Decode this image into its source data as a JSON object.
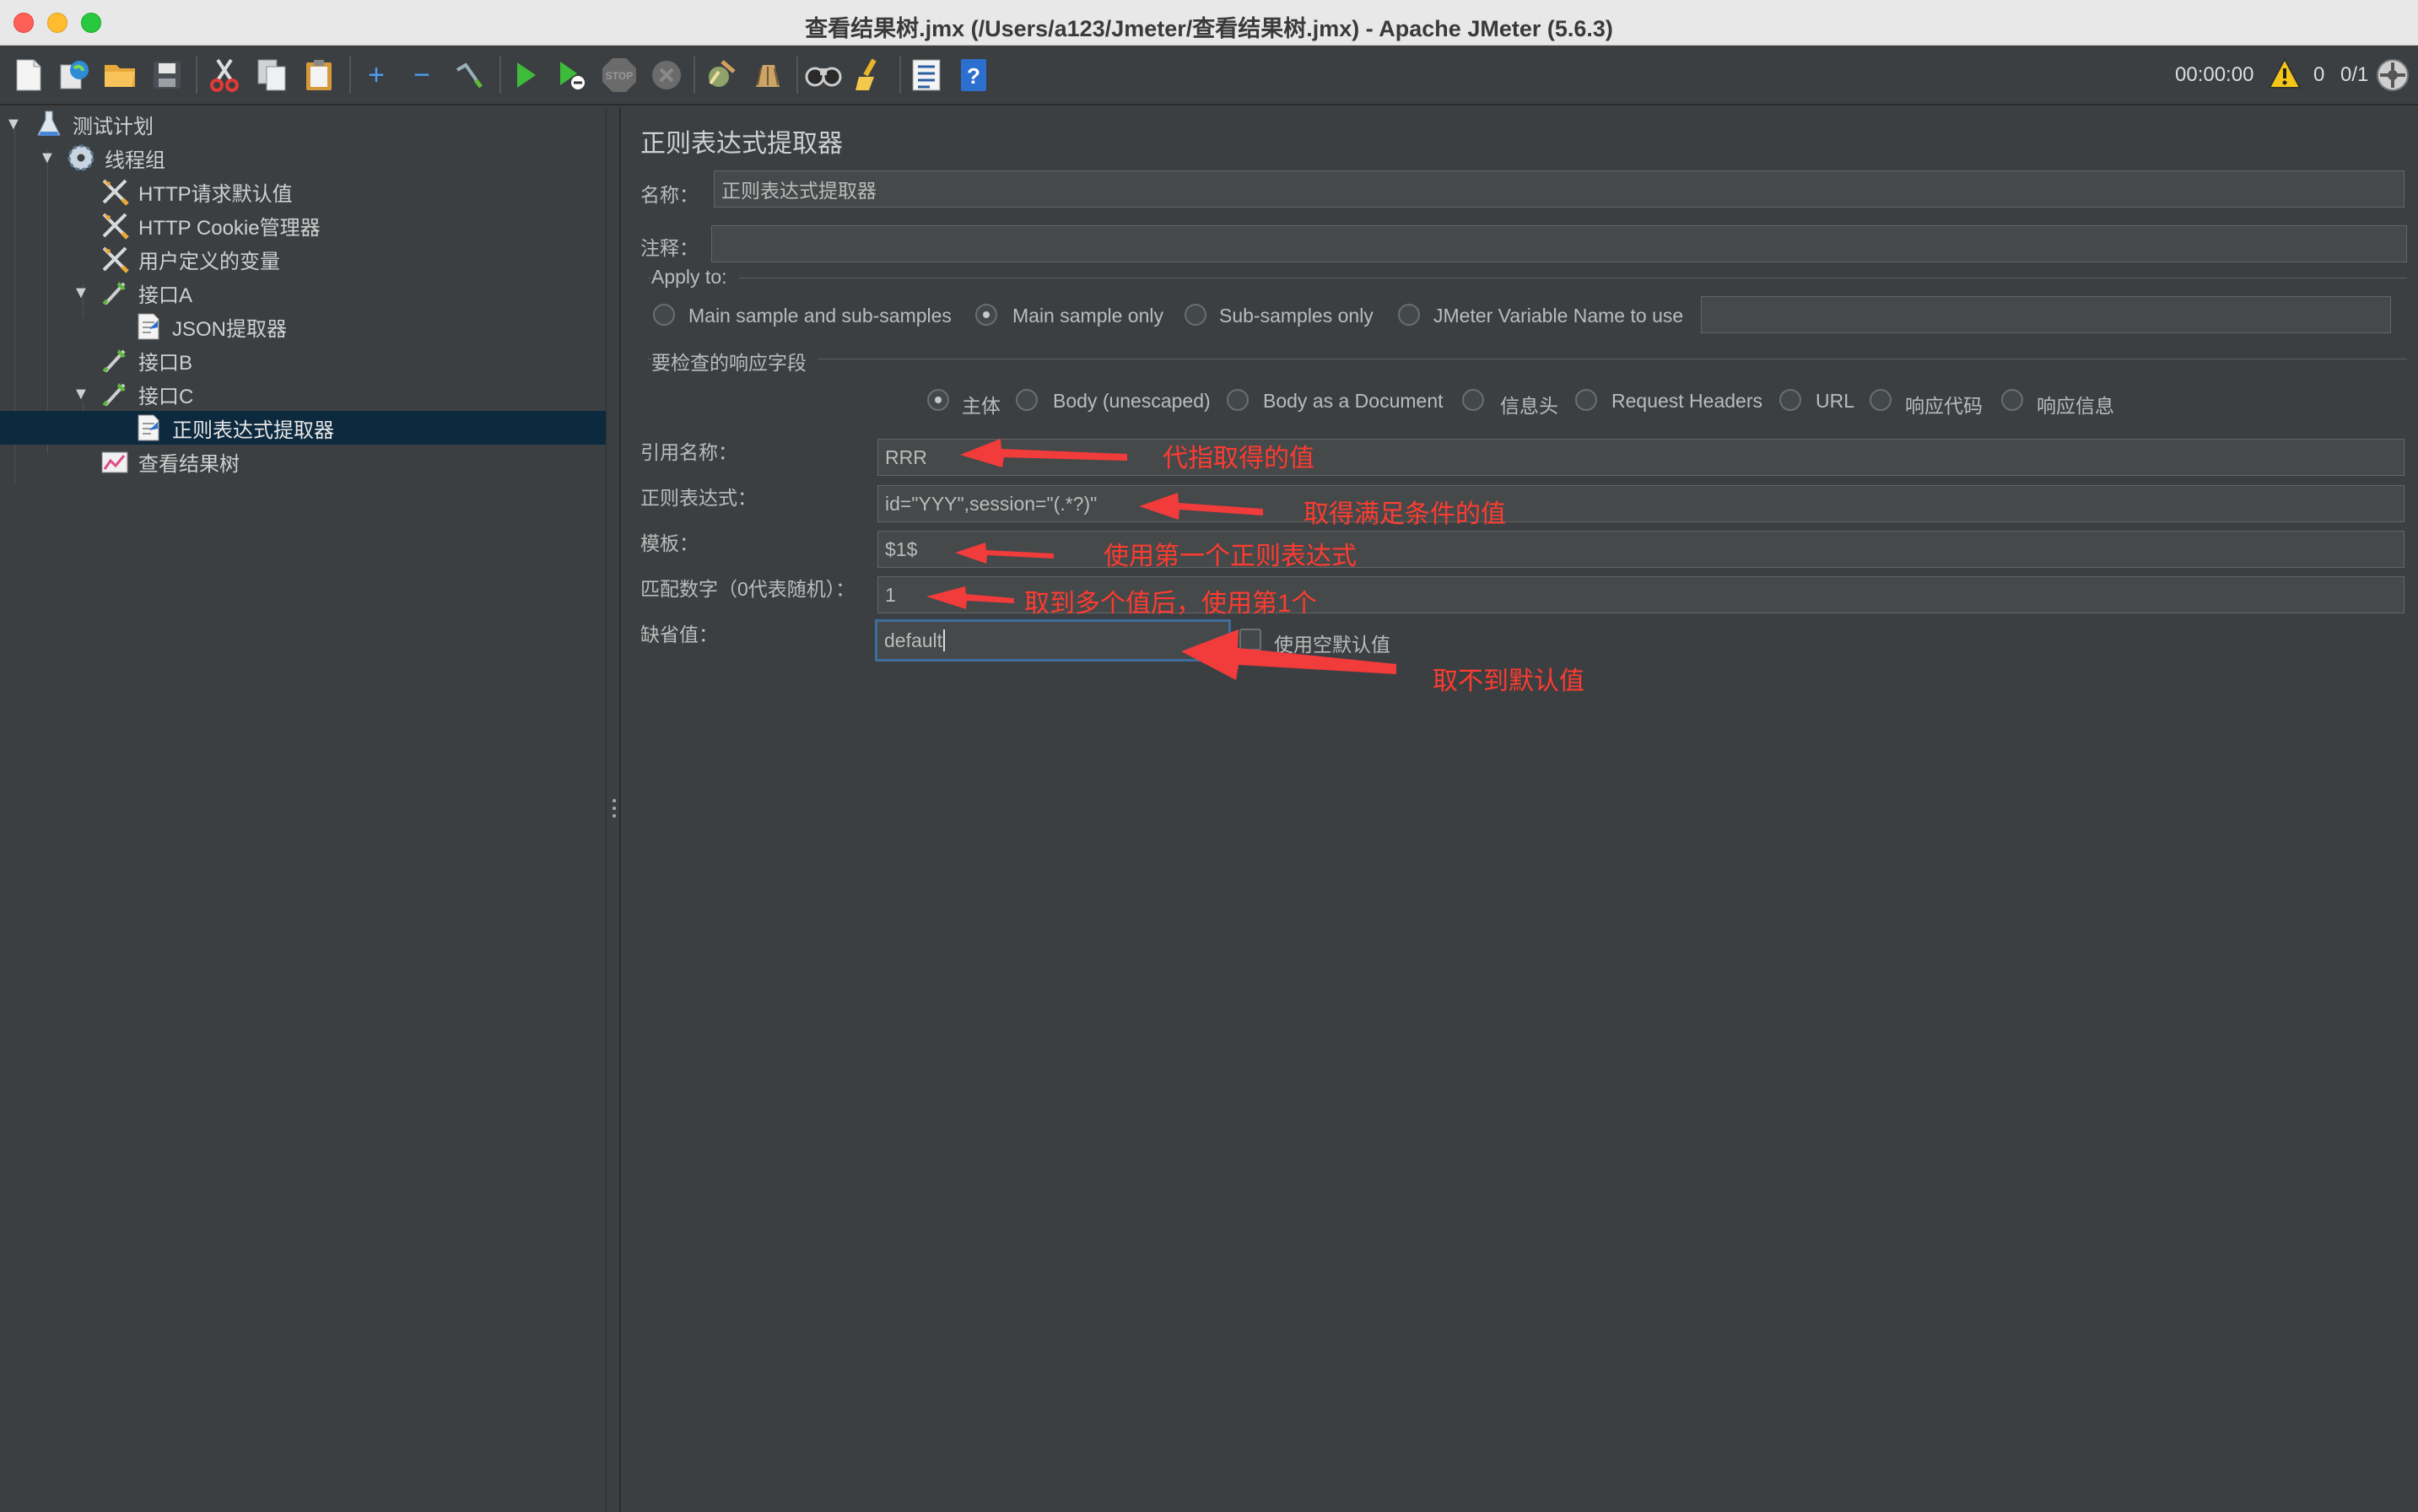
{
  "window": {
    "title": "查看结果树.jmx (/Users/a123/Jmeter/查看结果树.jmx) - Apache JMeter (5.6.3)"
  },
  "toolbar": {
    "icons": [
      "new-icon",
      "templates-icon",
      "open-icon",
      "save-icon",
      "cut-icon",
      "copy-icon",
      "paste-icon",
      "expand-icon",
      "collapse-icon",
      "toggle-icon",
      "start-icon",
      "start-no-pauses-icon",
      "stop-icon",
      "shutdown-icon",
      "clear-icon",
      "clear-all-icon",
      "search-icon",
      "reset-search-icon",
      "function-helper-icon",
      "help-icon"
    ],
    "timer": "00:00:00",
    "warning_count": "0",
    "threads": "0/1"
  },
  "tree": {
    "items": [
      {
        "label": "测试计划",
        "icon": "test-plan-icon"
      },
      {
        "label": "线程组",
        "icon": "thread-group-icon"
      },
      {
        "label": "HTTP请求默认值",
        "icon": "config-element-icon"
      },
      {
        "label": "HTTP Cookie管理器",
        "icon": "config-element-icon"
      },
      {
        "label": "用户定义的变量",
        "icon": "config-element-icon"
      },
      {
        "label": "接口A",
        "icon": "sampler-icon"
      },
      {
        "label": "JSON提取器",
        "icon": "post-processor-icon"
      },
      {
        "label": "接口B",
        "icon": "sampler-icon"
      },
      {
        "label": "接口C",
        "icon": "sampler-icon"
      },
      {
        "label": "正则表达式提取器",
        "icon": "post-processor-icon"
      },
      {
        "label": "查看结果树",
        "icon": "listener-icon"
      }
    ]
  },
  "panel": {
    "title": "正则表达式提取器",
    "name_label": "名称：",
    "name_value": "正则表达式提取器",
    "comment_label": "注释：",
    "comment_value": "",
    "apply_to": {
      "legend": "Apply to:",
      "options": [
        "Main sample and sub-samples",
        "Main sample only",
        "Sub-samples only",
        "JMeter Variable Name to use"
      ],
      "selected": "Main sample only",
      "variable_value": ""
    },
    "field_to_check": {
      "legend": "要检查的响应字段",
      "options": [
        "主体",
        "Body (unescaped)",
        "Body as a Document",
        "信息头",
        "Request Headers",
        "URL",
        "响应代码",
        "响应信息"
      ],
      "selected": "主体"
    },
    "ref_name_label": "引用名称：",
    "ref_name_value": "RRR",
    "regex_label": "正则表达式：",
    "regex_value": "id=\"YYY\",session=\"(.*?)\"",
    "template_label": "模板：",
    "template_value": "$1$",
    "match_no_label": "匹配数字（0代表随机）：",
    "match_no_value": "1",
    "default_label": "缺省值：",
    "default_value": "default",
    "use_empty_default_label": "使用空默认值"
  },
  "annotations": {
    "ref_name": "代指取得的值",
    "regex": "取得满足条件的值",
    "template": "使用第一个正则表达式",
    "match_no": "取到多个值后，使用第1个",
    "default": "取不到默认值",
    "color": "#ff3b30"
  },
  "colors": {
    "background": "#3c3f41",
    "selected_row": "#0d293e",
    "focus_border": "#3d6d9a"
  }
}
